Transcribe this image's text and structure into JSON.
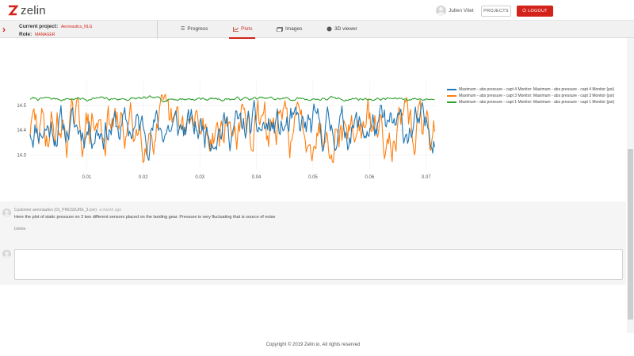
{
  "header": {
    "logo_text": "zelin",
    "user_name": "Julien Vitet",
    "projects_label": "PROJECTS",
    "logout_label": "LOGOUT"
  },
  "project_bar": {
    "project_label": "Current project:",
    "project_value": "Aeronautics_NLG",
    "role_label": "Role:",
    "role_value": "MANAGER",
    "tabs": [
      {
        "label": "Progress",
        "icon": "list-icon"
      },
      {
        "label": "Plots",
        "icon": "chart-icon",
        "active": true
      },
      {
        "label": "Images",
        "icon": "images-icon"
      },
      {
        "label": "3D viewer",
        "icon": "cube-icon"
      }
    ]
  },
  "chart_data": {
    "type": "line",
    "x_ticks": [
      "0.01",
      "0.02",
      "0.03",
      "0.04",
      "0.05",
      "0.06",
      "0.07"
    ],
    "y_ticks": [
      "14.5",
      "14.4",
      "14.3"
    ],
    "xlim": [
      0,
      0.072
    ],
    "ylim": [
      14.24,
      14.6
    ],
    "legend_position": "right",
    "series": [
      {
        "name": "Maximum - abs pressure - capt 4 Monitor: Maximum - abs pressure - capt 4 Monitor (psi)",
        "color": "#1f77b4",
        "mean": 14.41,
        "amplitude": 0.045
      },
      {
        "name": "Maximum - abs pressure - capt 3 Monitor: Maximum - abs pressure - capt 3 Monitor (psi)",
        "color": "#ff7f0e",
        "mean": 14.41,
        "amplitude": 0.06
      },
      {
        "name": "Maximum - abs pressure - capt 1 Monitor: Maximum - abs pressure - capt 1 Monitor (psi)",
        "color": "#2ca02c",
        "mean": 14.527,
        "amplitude": 0.004
      }
    ]
  },
  "comment": {
    "author": "Customer aeronautics (01_PRESSURE_3.csv)",
    "time_ago": "a month ago",
    "text": "Here the plot of static pressure on 2 two different sensors placed on the landing gear. Pressure is very fluctuating that is source of noise",
    "delete_label": "Delete",
    "input_placeholder": ""
  },
  "footer": {
    "copyright": "Copyright © 2019 Zelin.io. All rights reserved"
  }
}
